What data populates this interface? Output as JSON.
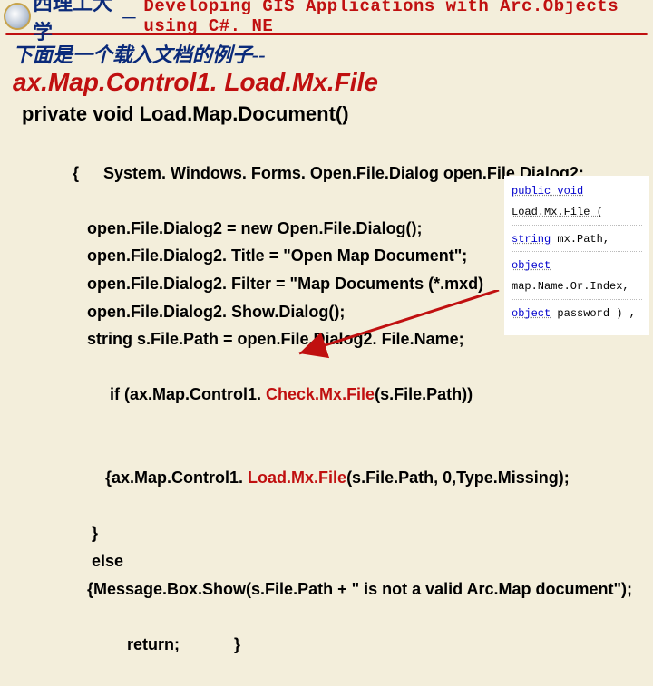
{
  "header": {
    "university": "西理工大学",
    "dash": "－",
    "course_title": "Developing GIS Applications with Arc.Objects using C#. NE"
  },
  "intro": "下面是一个载入文档的例子--",
  "heading": "ax.Map.Control1. Load.Mx.File",
  "method_sig": "private void Load.Map.Document()",
  "code": {
    "l1a": "{  ",
    "l1b": "System. Windows. Forms. Open.File.Dialog open.File.Dialog2;",
    "l2": "open.File.Dialog2 = new Open.File.Dialog();",
    "l3": "open.File.Dialog2. Title = \"Open Map Document\";",
    "l4": "open.File.Dialog2. Filter = \"Map Documents (*.mxd)",
    "l5": "open.File.Dialog2. Show.Dialog();",
    "l6": "string s.File.Path = open.File.Dialog2. File.Name;",
    "l7a": " if (ax.Map.Control1. ",
    "l7b": "Check.Mx.File",
    "l7c": "(s.File.Path))",
    "l8a": "{ax.Map.Control1. ",
    "l8b": "Load.Mx.File",
    "l8c": "(s.File.Path, 0,Type.Missing);",
    "l9": " }",
    "l10": " else",
    "l11": "{Message.Box.Show(s.File.Path + \" is not a valid Arc.Map document\");",
    "l12a": "return;",
    "l12b": "}"
  },
  "sig": {
    "r1_kw": "public void",
    "r1_name": " Load.Mx.File (",
    "r2_kw": "string",
    "r2_name": " mx.Path,",
    "r3_kw": "object",
    "r3_name": " map.Name.Or.Index,",
    "r4_kw": "object",
    "r4_name": " password ) ,"
  }
}
